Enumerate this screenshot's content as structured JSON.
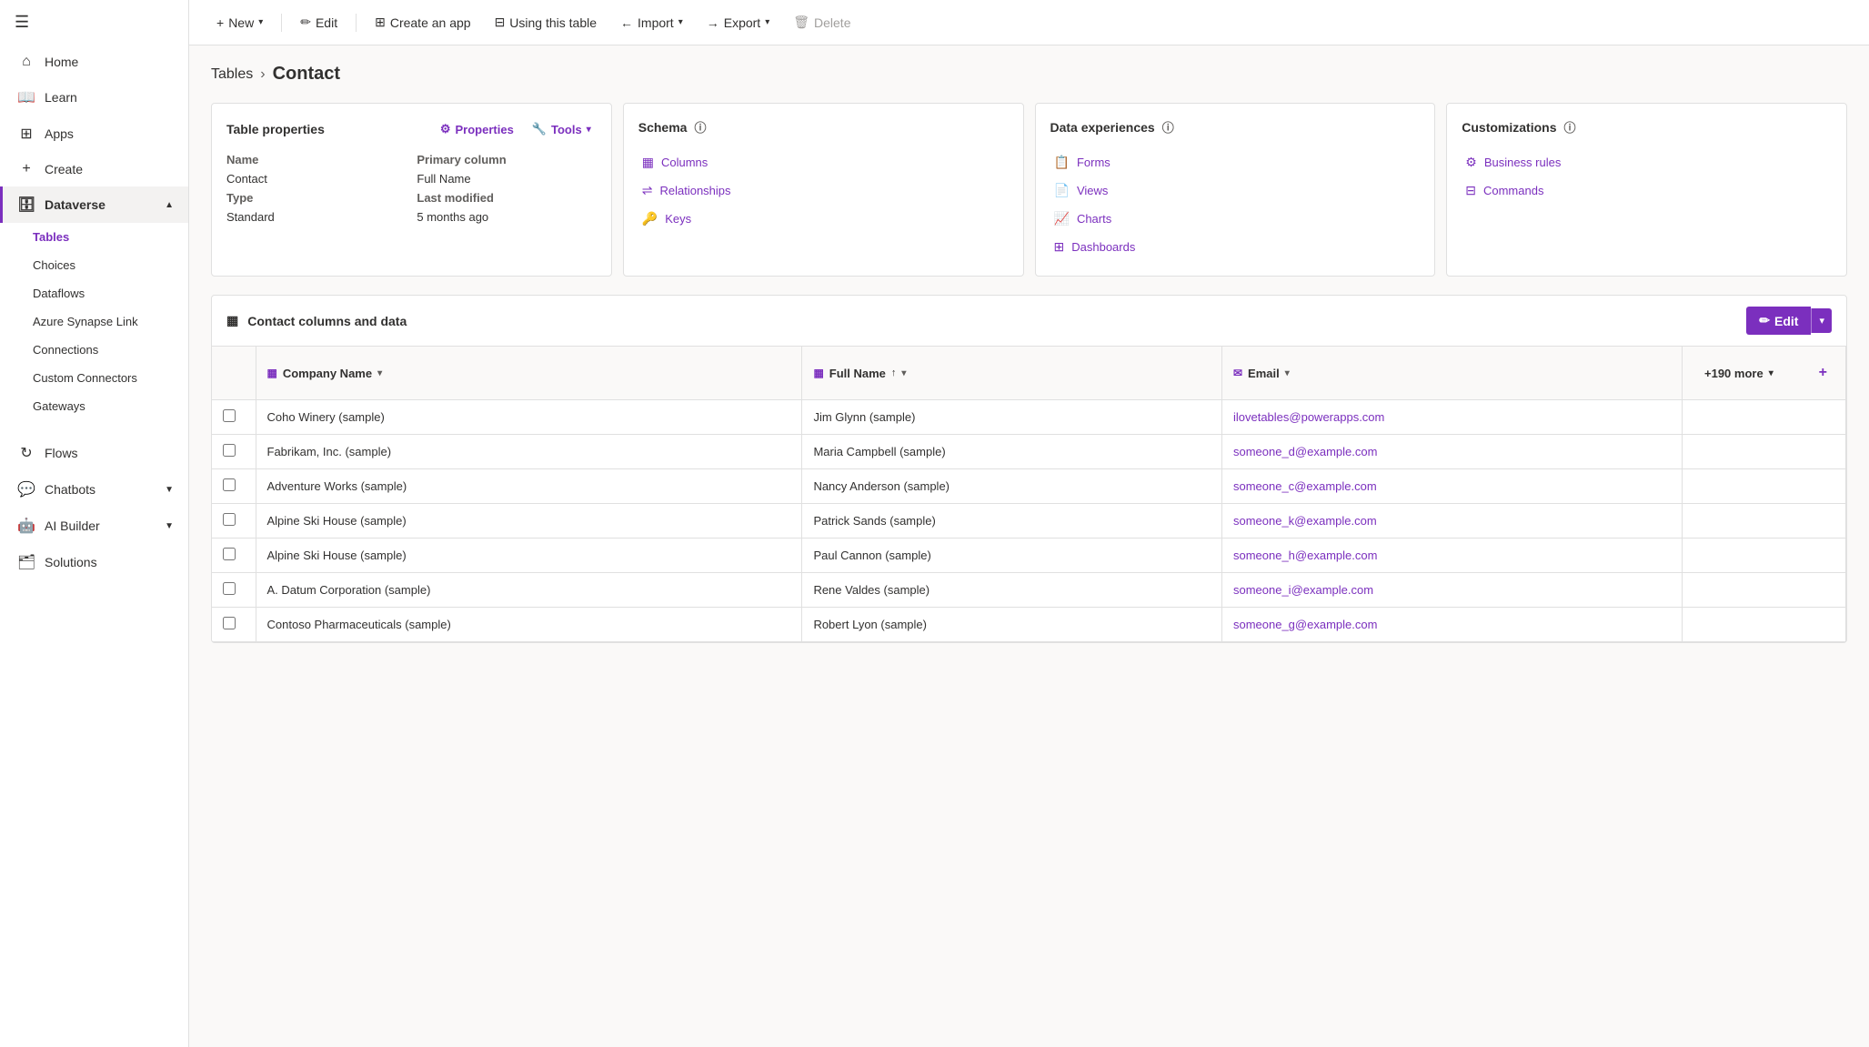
{
  "sidebar": {
    "hamburger": "☰",
    "items": [
      {
        "id": "home",
        "label": "Home",
        "icon": "⌂"
      },
      {
        "id": "learn",
        "label": "Learn",
        "icon": "📖"
      },
      {
        "id": "apps",
        "label": "Apps",
        "icon": "⊞"
      },
      {
        "id": "create",
        "label": "Create",
        "icon": "+"
      },
      {
        "id": "dataverse",
        "label": "Dataverse",
        "icon": "🗄",
        "chevron": "▲",
        "active": true
      }
    ],
    "subitems": [
      {
        "id": "tables",
        "label": "Tables",
        "active": true
      },
      {
        "id": "choices",
        "label": "Choices"
      },
      {
        "id": "dataflows",
        "label": "Dataflows"
      },
      {
        "id": "azure-synapse",
        "label": "Azure Synapse Link"
      },
      {
        "id": "connections",
        "label": "Connections"
      },
      {
        "id": "custom-connectors",
        "label": "Custom Connectors"
      },
      {
        "id": "gateways",
        "label": "Gateways"
      }
    ],
    "bottom_items": [
      {
        "id": "flows",
        "label": "Flows",
        "icon": "↻"
      },
      {
        "id": "chatbots",
        "label": "Chatbots",
        "icon": "💬",
        "chevron": "▼"
      },
      {
        "id": "ai-builder",
        "label": "AI Builder",
        "icon": "🤖",
        "chevron": "▼"
      },
      {
        "id": "solutions",
        "label": "Solutions",
        "icon": "🗂"
      }
    ]
  },
  "toolbar": {
    "new_label": "New",
    "new_icon": "+",
    "edit_label": "Edit",
    "edit_icon": "✏",
    "create_app_label": "Create an app",
    "create_app_icon": "⊞",
    "using_table_label": "Using this table",
    "using_table_icon": "⊟",
    "import_label": "Import",
    "import_icon": "←",
    "export_label": "Export",
    "export_icon": "→",
    "delete_label": "Delete",
    "delete_icon": "🗑"
  },
  "breadcrumb": {
    "tables_label": "Tables",
    "separator": ">",
    "current": "Contact"
  },
  "table_properties": {
    "card_title": "Table properties",
    "properties_btn": "Properties",
    "tools_btn": "Tools",
    "name_label": "Name",
    "name_value": "Contact",
    "primary_col_label": "Primary column",
    "primary_col_value": "Full Name",
    "type_label": "Type",
    "type_value": "Standard",
    "last_modified_label": "Last modified",
    "last_modified_value": "5 months ago"
  },
  "schema": {
    "card_title": "Schema",
    "info_icon": "ℹ",
    "items": [
      {
        "id": "columns",
        "label": "Columns",
        "icon": "▦"
      },
      {
        "id": "relationships",
        "label": "Relationships",
        "icon": "⇌"
      },
      {
        "id": "keys",
        "label": "Keys",
        "icon": "🔑"
      }
    ]
  },
  "data_experiences": {
    "card_title": "Data experiences",
    "info_icon": "ℹ",
    "items": [
      {
        "id": "forms",
        "label": "Forms",
        "icon": "📋"
      },
      {
        "id": "views",
        "label": "Views",
        "icon": "📄"
      },
      {
        "id": "charts",
        "label": "Charts",
        "icon": "📈"
      },
      {
        "id": "dashboards",
        "label": "Dashboards",
        "icon": "⊞"
      }
    ]
  },
  "customizations": {
    "card_title": "Customizations",
    "info_icon": "ℹ",
    "items": [
      {
        "id": "business-rules",
        "label": "Business rules",
        "icon": "⚙"
      },
      {
        "id": "commands",
        "label": "Commands",
        "icon": "⊟"
      }
    ]
  },
  "data_section": {
    "title": "Contact columns and data",
    "title_icon": "▦",
    "edit_label": "Edit",
    "edit_icon": "✏"
  },
  "table_headers": {
    "checkbox": "",
    "company_name": "Company Name",
    "company_name_icon": "▦",
    "full_name": "Full Name",
    "full_name_icon": "▦",
    "full_name_sort": "↑",
    "email": "Email",
    "email_icon": "✉",
    "more_cols": "+190 more",
    "add_col": "+"
  },
  "table_rows": [
    {
      "company": "Coho Winery (sample)",
      "full_name": "Jim Glynn (sample)",
      "email": "ilovetables@powerapps.com"
    },
    {
      "company": "Fabrikam, Inc. (sample)",
      "full_name": "Maria Campbell (sample)",
      "email": "someone_d@example.com"
    },
    {
      "company": "Adventure Works (sample)",
      "full_name": "Nancy Anderson (sample)",
      "email": "someone_c@example.com"
    },
    {
      "company": "Alpine Ski House (sample)",
      "full_name": "Patrick Sands (sample)",
      "email": "someone_k@example.com"
    },
    {
      "company": "Alpine Ski House (sample)",
      "full_name": "Paul Cannon (sample)",
      "email": "someone_h@example.com"
    },
    {
      "company": "A. Datum Corporation (sample)",
      "full_name": "Rene Valdes (sample)",
      "email": "someone_i@example.com"
    },
    {
      "company": "Contoso Pharmaceuticals (sample)",
      "full_name": "Robert Lyon (sample)",
      "email": "someone_g@example.com"
    }
  ]
}
